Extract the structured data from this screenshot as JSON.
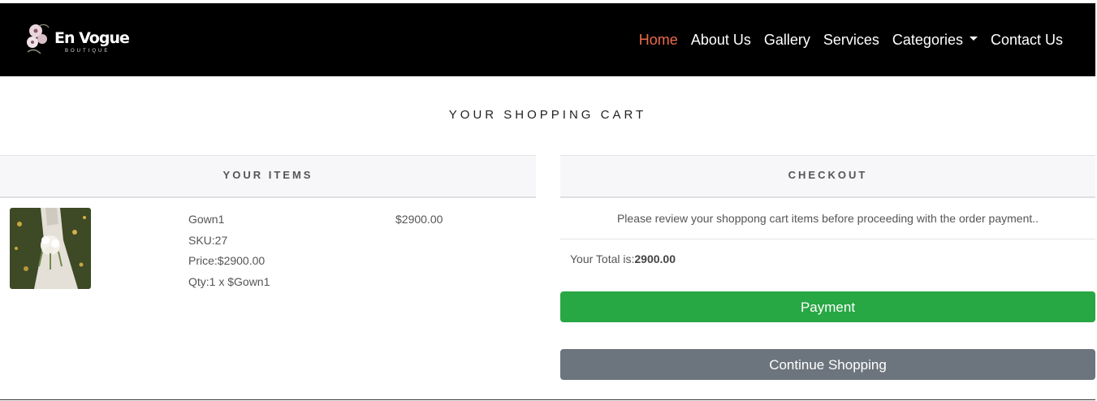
{
  "navbar": {
    "brand": {
      "name": "En Vogue",
      "subtitle": "BOUTIQUE",
      "logo_icon": "flower-logo-icon"
    },
    "links": [
      {
        "label": "Home",
        "active": true
      },
      {
        "label": "About Us",
        "active": false
      },
      {
        "label": "Gallery",
        "active": false
      },
      {
        "label": "Services",
        "active": false
      },
      {
        "label": "Categories",
        "active": false,
        "dropdown": true
      },
      {
        "label": "Contact Us",
        "active": false
      }
    ],
    "background": "#000000",
    "active_color": "#ec6b4a"
  },
  "page": {
    "title": "YOUR SHOPPING CART"
  },
  "items_panel": {
    "header": "YOUR ITEMS",
    "items": [
      {
        "name": "Gown1",
        "sku": "SKU:27",
        "price_label": "Price:$2900.00",
        "qty_label": "Qty:1 x $Gown1",
        "line_total": "$2900.00",
        "image_icon": "bride-photo-thumbnail"
      }
    ]
  },
  "checkout_panel": {
    "header": "CHECKOUT",
    "note": "Please review your shoppong cart items before proceeding with the order payment..",
    "total_prefix": "Your Total is:",
    "total_value": "2900.00",
    "payment_label": "Payment",
    "continue_label": "Continue Shopping",
    "payment_color": "#28a745",
    "continue_color": "#6c757d"
  }
}
